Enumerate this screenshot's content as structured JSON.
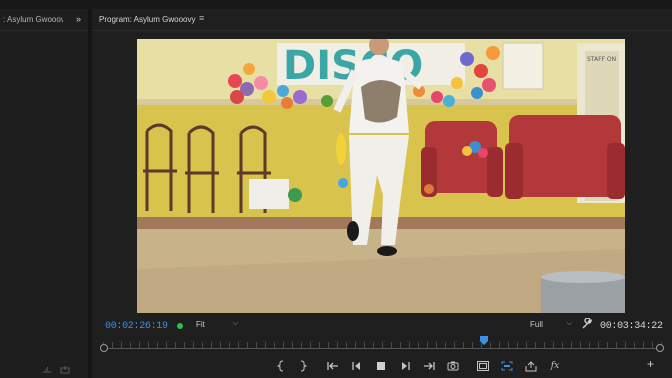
{
  "source_panel": {
    "title": ": Asylum Gwooovy"
  },
  "program_monitor": {
    "title": "Program: Asylum Gwooovy",
    "current_timecode": "00:02:26:19",
    "zoom": "Fit",
    "resolution": "Full",
    "duration_timecode": "00:03:34:22",
    "playhead_fraction": 0.68
  },
  "video_frame": {
    "banner_text": "DISCO",
    "sign_text": "STAFF ON"
  },
  "colors": {
    "accent": "#3e8fe6",
    "status_dot": "#2fc04a",
    "wall": "#d9c24a",
    "floor": "#c9b48a"
  },
  "controls": [
    "mark-in-icon",
    "mark-out-icon",
    "go-to-in-icon",
    "step-back-icon",
    "stop-icon",
    "step-forward-icon",
    "go-to-out-icon",
    "export-frame-icon",
    "safe-margins-icon",
    "comparison-view-icon",
    "share-icon",
    "fx-icon",
    "add-button-icon"
  ]
}
